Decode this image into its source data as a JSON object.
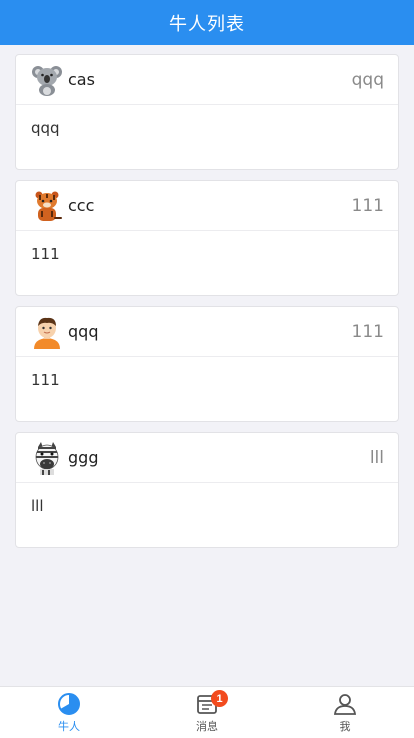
{
  "header": {
    "title": "牛人列表"
  },
  "cards": [
    {
      "avatar": "koala-avatar-icon",
      "name": "cas",
      "right": "qqq",
      "body": "qqq"
    },
    {
      "avatar": "tiger-avatar-icon",
      "name": "ccc",
      "right": "111",
      "body": "111"
    },
    {
      "avatar": "boy-avatar-icon",
      "name": "qqq",
      "right": "111",
      "body": "111"
    },
    {
      "avatar": "zebra-avatar-icon",
      "name": "ggg",
      "right": "lll",
      "body": "lll"
    }
  ],
  "tabbar": {
    "tabs": [
      {
        "label": "牛人",
        "icon": "pie-chart-icon",
        "active": true
      },
      {
        "label": "消息",
        "icon": "message-list-icon",
        "badge": "1"
      },
      {
        "label": "我",
        "icon": "user-icon"
      }
    ]
  },
  "colors": {
    "primary": "#2a8ef0",
    "badge": "#f24b1e",
    "background": "#f2f2f7"
  }
}
